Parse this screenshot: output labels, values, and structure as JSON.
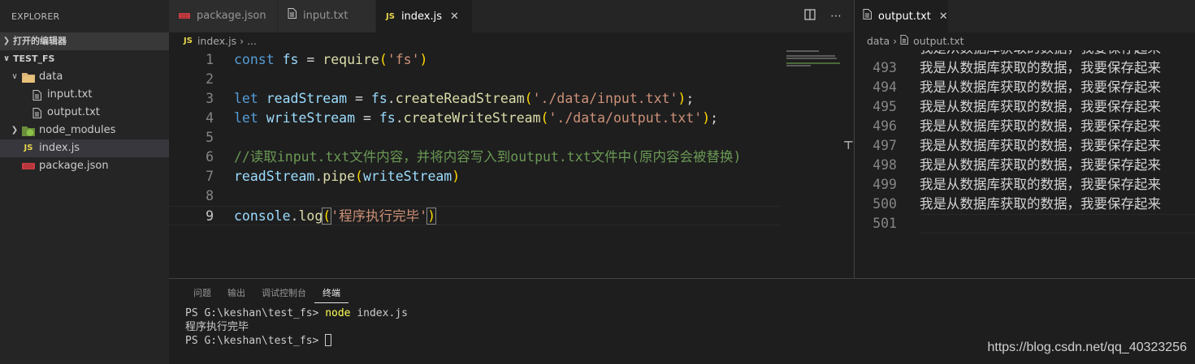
{
  "sidebar": {
    "title": "EXPLORER",
    "open_editors": "打开的编辑器",
    "root": "TEST_FS",
    "items": [
      {
        "label": "data"
      },
      {
        "label": "input.txt"
      },
      {
        "label": "output.txt"
      },
      {
        "label": "node_modules"
      },
      {
        "label": "index.js"
      },
      {
        "label": "package.json"
      }
    ]
  },
  "group1": {
    "tabs": [
      {
        "label": "package.json",
        "icon": "json-icon"
      },
      {
        "label": "input.txt",
        "icon": "file-icon"
      },
      {
        "label": "index.js",
        "icon": "js-icon",
        "active": true
      }
    ],
    "breadcrumb": {
      "file": "index.js",
      "more": "..."
    },
    "code": [
      {
        "n": "1"
      },
      {
        "n": "2"
      },
      {
        "n": "3"
      },
      {
        "n": "4"
      },
      {
        "n": "5"
      },
      {
        "n": "6",
        "comment": "//读取input.txt文件内容，并将内容写入到output.txt文件中(原内容会被替换)"
      },
      {
        "n": "7"
      },
      {
        "n": "8"
      },
      {
        "n": "9"
      }
    ],
    "tokens": {
      "const": "const",
      "fs": "fs",
      "require": "require",
      "fs_str": "'fs'",
      "let": "let",
      "readStream": "readStream",
      "writeStream": "writeStream",
      "createReadStream": "createReadStream",
      "createWriteStream": "createWriteStream",
      "input_path": "'./data/input.txt'",
      "output_path": "'./data/output.txt'",
      "pipe": "pipe",
      "console": "console",
      "log": "log",
      "done_str": "'程序执行完毕'"
    }
  },
  "group2": {
    "tab": {
      "label": "output.txt",
      "icon": "file-icon"
    },
    "breadcrumb": {
      "folder": "data",
      "file": "output.txt"
    },
    "partial_line": "我是从数据库获取的数据，我要保存起来",
    "lines": [
      {
        "n": "493",
        "text": "我是从数据库获取的数据，我要保存起来"
      },
      {
        "n": "494",
        "text": "我是从数据库获取的数据，我要保存起来"
      },
      {
        "n": "495",
        "text": "我是从数据库获取的数据，我要保存起来"
      },
      {
        "n": "496",
        "text": "我是从数据库获取的数据，我要保存起来"
      },
      {
        "n": "497",
        "text": "我是从数据库获取的数据，我要保存起来"
      },
      {
        "n": "498",
        "text": "我是从数据库获取的数据，我要保存起来"
      },
      {
        "n": "499",
        "text": "我是从数据库获取的数据，我要保存起来"
      },
      {
        "n": "500",
        "text": "我是从数据库获取的数据，我要保存起来"
      },
      {
        "n": "501",
        "text": ""
      }
    ]
  },
  "panel": {
    "tabs": [
      "问题",
      "输出",
      "调试控制台",
      "终端"
    ],
    "active_tab": "终端",
    "terminal": {
      "prompt1": "PS G:\\keshan\\test_fs> ",
      "cmd_node": "node",
      "cmd_args": " index.js",
      "output": "程序执行完毕",
      "prompt2": "PS G:\\keshan\\test_fs> "
    }
  },
  "watermark": "https://blog.csdn.net/qq_40323256",
  "colors": {
    "keyword": "#569cd6",
    "string": "#ce9178",
    "function": "#dcdcaa",
    "variable": "#9cdcfe",
    "comment": "#6a9955"
  }
}
